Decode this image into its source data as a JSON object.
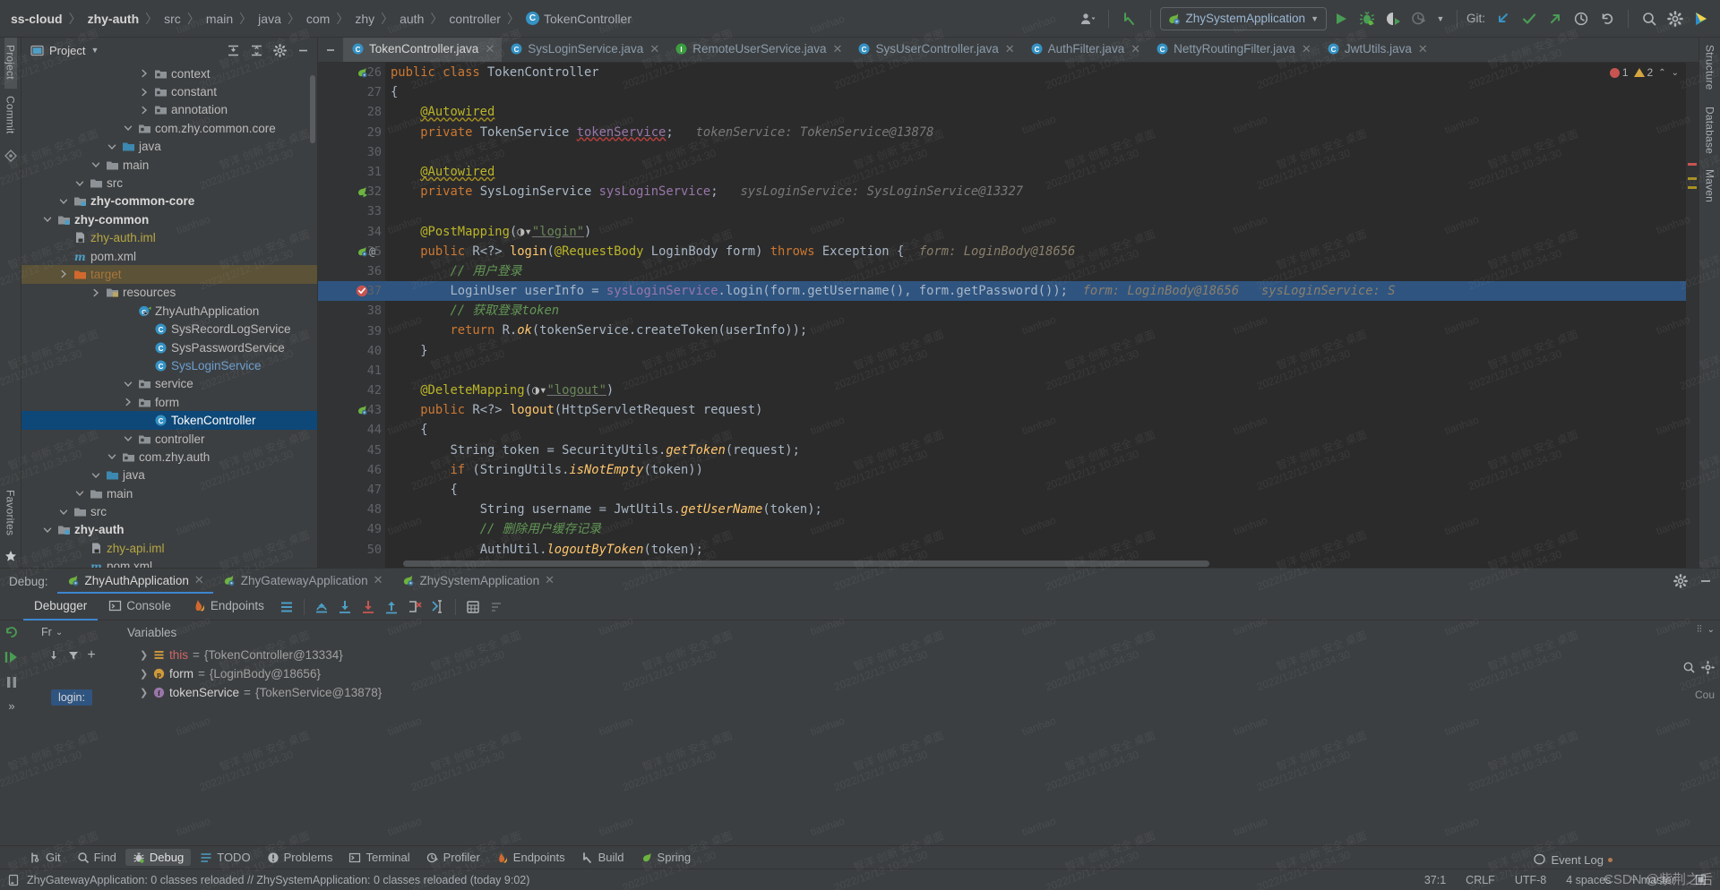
{
  "window": {
    "breadcrumbs": [
      {
        "label": "ss-cloud",
        "bold": true
      },
      {
        "label": "zhy-auth",
        "bold": true
      },
      {
        "label": "src",
        "bold": false
      },
      {
        "label": "main",
        "bold": false
      },
      {
        "label": "java",
        "bold": false
      },
      {
        "label": "com",
        "bold": false
      },
      {
        "label": "zhy",
        "bold": false
      },
      {
        "label": "auth",
        "bold": false
      },
      {
        "label": "controller",
        "bold": false
      },
      {
        "label": "TokenController",
        "bold": false,
        "icon": "class-icon"
      }
    ]
  },
  "toolbar": {
    "run_config": "ZhySystemApplication",
    "run_config_icon": "spring-boot-icon",
    "git_label": "Git:",
    "buttons": [
      {
        "name": "account-icon",
        "title": "Account"
      },
      {
        "name": "back-arrow-icon",
        "title": "Navigate Back"
      },
      {
        "name": "run-button",
        "title": "Run"
      },
      {
        "name": "debug-button",
        "title": "Debug"
      },
      {
        "name": "run-with-coverage-button",
        "title": "Run with Coverage"
      },
      {
        "name": "profiler-button",
        "title": "Profiler"
      },
      {
        "name": "update-project-button",
        "title": "Update Project"
      },
      {
        "name": "commit-button",
        "title": "Commit"
      },
      {
        "name": "push-button",
        "title": "Push"
      },
      {
        "name": "history-button",
        "title": "History"
      },
      {
        "name": "rollback-button",
        "title": "Rollback"
      },
      {
        "name": "search-everywhere-button",
        "title": "Search Everywhere"
      },
      {
        "name": "settings-gear-button",
        "title": "Settings"
      },
      {
        "name": "ide-logo-icon",
        "title": "IDE"
      }
    ]
  },
  "left_rail": [
    "Project",
    "Commit"
  ],
  "right_rail": [
    "Structure",
    "Database",
    "Maven"
  ],
  "project_panel": {
    "title": "Project",
    "tree": [
      {
        "indent": 3,
        "icon": "maven-icon",
        "label": "pom.xml",
        "color": "",
        "arrow": "",
        "state": ""
      },
      {
        "indent": 3,
        "icon": "iml-icon",
        "label": "zhy-api.iml",
        "color": "yellow",
        "arrow": "",
        "state": ""
      },
      {
        "indent": 1,
        "icon": "module-icon",
        "label": "zhy-auth",
        "color": "bold",
        "arrow": "down",
        "state": ""
      },
      {
        "indent": 2,
        "icon": "folder-icon",
        "label": "src",
        "color": "",
        "arrow": "down",
        "state": ""
      },
      {
        "indent": 3,
        "icon": "folder-icon",
        "label": "main",
        "color": "",
        "arrow": "down",
        "state": ""
      },
      {
        "indent": 4,
        "icon": "source-folder-icon",
        "label": "java",
        "color": "",
        "arrow": "down",
        "state": ""
      },
      {
        "indent": 5,
        "icon": "package-icon",
        "label": "com.zhy.auth",
        "color": "",
        "arrow": "down",
        "state": ""
      },
      {
        "indent": 6,
        "icon": "package-icon",
        "label": "controller",
        "color": "",
        "arrow": "down",
        "state": ""
      },
      {
        "indent": 7,
        "icon": "class-icon",
        "label": "TokenController",
        "color": "sel",
        "arrow": "",
        "state": "selected"
      },
      {
        "indent": 6,
        "icon": "package-icon",
        "label": "form",
        "color": "",
        "arrow": "right",
        "state": ""
      },
      {
        "indent": 6,
        "icon": "package-icon",
        "label": "service",
        "color": "",
        "arrow": "down",
        "state": ""
      },
      {
        "indent": 7,
        "icon": "class-icon",
        "label": "SysLoginService",
        "color": "blue",
        "arrow": "",
        "state": ""
      },
      {
        "indent": 7,
        "icon": "class-icon",
        "label": "SysPasswordService",
        "color": "",
        "arrow": "",
        "state": ""
      },
      {
        "indent": 7,
        "icon": "class-icon",
        "label": "SysRecordLogService",
        "color": "",
        "arrow": "",
        "state": ""
      },
      {
        "indent": 6,
        "icon": "spring-class-icon",
        "label": "ZhyAuthApplication",
        "color": "",
        "arrow": "",
        "state": ""
      },
      {
        "indent": 4,
        "icon": "resources-folder-icon",
        "label": "resources",
        "color": "",
        "arrow": "right",
        "state": ""
      },
      {
        "indent": 2,
        "icon": "target-folder-icon",
        "label": "target",
        "color": "orange",
        "arrow": "right",
        "state": "highlight"
      },
      {
        "indent": 2,
        "icon": "maven-icon",
        "label": "pom.xml",
        "color": "",
        "arrow": "",
        "state": ""
      },
      {
        "indent": 2,
        "icon": "iml-icon",
        "label": "zhy-auth.iml",
        "color": "yellow",
        "arrow": "",
        "state": ""
      },
      {
        "indent": 1,
        "icon": "module-icon",
        "label": "zhy-common",
        "color": "bold",
        "arrow": "down",
        "state": ""
      },
      {
        "indent": 2,
        "icon": "module-icon",
        "label": "zhy-common-core",
        "color": "bold",
        "arrow": "down",
        "state": ""
      },
      {
        "indent": 3,
        "icon": "folder-icon",
        "label": "src",
        "color": "",
        "arrow": "down",
        "state": ""
      },
      {
        "indent": 4,
        "icon": "folder-icon",
        "label": "main",
        "color": "",
        "arrow": "down",
        "state": ""
      },
      {
        "indent": 5,
        "icon": "source-folder-icon",
        "label": "java",
        "color": "",
        "arrow": "down",
        "state": ""
      },
      {
        "indent": 6,
        "icon": "package-icon",
        "label": "com.zhy.common.core",
        "color": "",
        "arrow": "down",
        "state": ""
      },
      {
        "indent": 7,
        "icon": "package-icon",
        "label": "annotation",
        "color": "",
        "arrow": "right",
        "state": ""
      },
      {
        "indent": 7,
        "icon": "package-icon",
        "label": "constant",
        "color": "",
        "arrow": "right",
        "state": ""
      },
      {
        "indent": 7,
        "icon": "package-icon",
        "label": "context",
        "color": "",
        "arrow": "right",
        "state": ""
      }
    ]
  },
  "editor": {
    "tabs": [
      {
        "label": "TokenController.java",
        "icon": "class-icon",
        "active": true
      },
      {
        "label": "SysLoginService.java",
        "icon": "class-icon",
        "active": false
      },
      {
        "label": "RemoteUserService.java",
        "icon": "interface-icon",
        "active": false
      },
      {
        "label": "SysUserController.java",
        "icon": "class-icon",
        "active": false
      },
      {
        "label": "AuthFilter.java",
        "icon": "class-icon",
        "active": false
      },
      {
        "label": "NettyRoutingFilter.java",
        "icon": "class-icon",
        "active": false
      },
      {
        "label": "JwtUtils.java",
        "icon": "class-icon",
        "active": false
      }
    ],
    "inspection": {
      "errors": "1",
      "warnings": "2"
    },
    "lines": [
      {
        "num": "26",
        "gutter": "spring-bean-icon",
        "html": "<span class=\"kw\">public class </span><span class=\"cls\">TokenController</span>"
      },
      {
        "num": "27",
        "gutter": "",
        "html": "<span class=\"txt\">{</span>"
      },
      {
        "num": "28",
        "gutter": "",
        "html": "    <span class=\"ann wavy-y\">@Autowired</span>"
      },
      {
        "num": "29",
        "gutter": "",
        "html": "    <span class=\"kw\">private </span><span class=\"cls\">TokenService </span><span class=\"fld wavy\">tokenService</span><span class=\"txt\">;</span>   <span class=\"hint\">tokenService: TokenService@13878</span>"
      },
      {
        "num": "30",
        "gutter": "",
        "html": ""
      },
      {
        "num": "31",
        "gutter": "",
        "html": "    <span class=\"ann wavy-y\">@Autowired</span>"
      },
      {
        "num": "32",
        "gutter": "spring-arrow-icon",
        "html": "    <span class=\"kw\">private </span><span class=\"cls\">SysLoginService </span><span class=\"fld\">sysLoginService</span><span class=\"txt\">;</span>   <span class=\"hint\">sysLoginService: SysLoginService@13327</span>"
      },
      {
        "num": "33",
        "gutter": "",
        "html": ""
      },
      {
        "num": "34",
        "gutter": "",
        "html": "    <span class=\"ann\">@PostMapping</span><span class=\"txt\">(</span><span class=\"gicon\">◑▾</span><span class=\"str sel-w\">\"login\"</span><span class=\"txt\">)</span>"
      },
      {
        "num": "35",
        "gutter": "spring-bean-icon,at-icon",
        "html": "    <span class=\"kw\">public </span><span class=\"cls\">R&lt;?&gt; </span><span class=\"mth\">login</span><span class=\"txt\">(</span><span class=\"ann\">@RequestBody </span><span class=\"cls\">LoginBody form</span><span class=\"txt\">) </span><span class=\"kw\">throws </span><span class=\"cls\">Exception </span><span class=\"txt\">{</span>  <span class=\"hintv\">form: LoginBody@18656</span>"
      },
      {
        "num": "36",
        "gutter": "",
        "html": "        <span class=\"cmt\">// 用户登录</span>"
      },
      {
        "num": "37",
        "gutter": "breakpoint-hit-icon",
        "highlight": true,
        "html": "        <span class=\"cls\">LoginUser userInfo</span> <span class=\"txt\">=</span> <span class=\"fld\">sysLoginService</span><span class=\"txt\">.</span><span class=\"txt\">login(form.getUsername(), form.getPassword());</span>  <span class=\"hintv\">form: LoginBody@18656</span>   <span class=\"hintv\">sysLoginService: S</span>"
      },
      {
        "num": "38",
        "gutter": "",
        "html": "        <span class=\"cmt\">// 获取登录token</span>"
      },
      {
        "num": "39",
        "gutter": "",
        "html": "        <span class=\"kw\">return </span><span class=\"cls\">R</span><span class=\"txt\">.</span><span class=\"mth\" style=\"font-style:italic\">ok</span><span class=\"txt\">(tokenService.createToken(userInfo));</span>"
      },
      {
        "num": "40",
        "gutter": "",
        "html": "    <span class=\"txt\">}</span>"
      },
      {
        "num": "41",
        "gutter": "",
        "html": ""
      },
      {
        "num": "42",
        "gutter": "",
        "html": "    <span class=\"ann\">@DeleteMapping</span><span class=\"txt\">(</span><span class=\"gicon\">◑▾</span><span class=\"str sel-w\">\"logout\"</span><span class=\"txt\">)</span>"
      },
      {
        "num": "43",
        "gutter": "spring-bean-icon",
        "html": "    <span class=\"kw\">public </span><span class=\"cls\">R&lt;?&gt; </span><span class=\"mth\">logout</span><span class=\"txt\">(</span><span class=\"cls\">HttpServletRequest request</span><span class=\"txt\">)</span>"
      },
      {
        "num": "44",
        "gutter": "",
        "html": "    <span class=\"txt\">{</span>"
      },
      {
        "num": "45",
        "gutter": "",
        "html": "        <span class=\"cls\">String token </span><span class=\"txt\">= </span><span class=\"cls\">SecurityUtils</span><span class=\"txt\">.</span><span class=\"mth\" style=\"font-style:italic\">getToken</span><span class=\"txt\">(request);</span>"
      },
      {
        "num": "46",
        "gutter": "",
        "html": "        <span class=\"kw\">if </span><span class=\"txt\">(</span><span class=\"cls\">StringUtils</span><span class=\"txt\">.</span><span class=\"mth\" style=\"font-style:italic\">isNotEmpty</span><span class=\"txt\">(token))</span>"
      },
      {
        "num": "47",
        "gutter": "",
        "html": "        <span class=\"txt\">{</span>"
      },
      {
        "num": "48",
        "gutter": "",
        "html": "            <span class=\"cls\">String username </span><span class=\"txt\">= </span><span class=\"cls\">JwtUtils</span><span class=\"txt\">.</span><span class=\"mth\" style=\"font-style:italic\">getUserName</span><span class=\"txt\">(token);</span>"
      },
      {
        "num": "49",
        "gutter": "",
        "html": "            <span class=\"cmt\">// 删除用户缓存记录</span>"
      },
      {
        "num": "50",
        "gutter": "",
        "html": "            <span class=\"cls\">AuthUtil</span><span class=\"txt\">.</span><span class=\"mth\" style=\"font-style:italic\">logoutByToken</span><span class=\"txt\">(token);</span>"
      }
    ]
  },
  "debug": {
    "label": "Debug:",
    "sessions": [
      {
        "label": "ZhyAuthApplication",
        "active": true
      },
      {
        "label": "ZhyGatewayApplication",
        "active": false
      },
      {
        "label": "ZhySystemApplication",
        "active": false
      }
    ],
    "subtabs": [
      {
        "label": "Debugger",
        "icon": "",
        "active": true
      },
      {
        "label": "Console",
        "icon": "console-icon",
        "active": false
      },
      {
        "label": "Endpoints",
        "icon": "endpoints-icon",
        "active": false
      }
    ],
    "step_buttons": [
      {
        "name": "show-execution-point-button"
      },
      {
        "name": "step-over-button"
      },
      {
        "name": "step-into-button"
      },
      {
        "name": "force-step-into-button"
      },
      {
        "name": "step-out-button"
      },
      {
        "name": "drop-frame-button"
      },
      {
        "name": "run-to-cursor-button"
      },
      {
        "name": "evaluate-expression-button"
      },
      {
        "name": "settings-button"
      }
    ],
    "frames_label": "Fr",
    "variables_label": "Variables",
    "frame_current": "login:",
    "variables": [
      {
        "icon": "this-icon",
        "name": "this",
        "eq": "=",
        "value": "{TokenController@13334}",
        "expandable": true
      },
      {
        "icon": "param-icon",
        "name": "form",
        "eq": "=",
        "value": "{LoginBody@18656}",
        "expandable": true
      },
      {
        "icon": "field-icon",
        "name": "tokenService",
        "eq": "=",
        "value": "{TokenService@13878}",
        "expandable": true
      }
    ]
  },
  "tool_windows": [
    {
      "label": "Git",
      "icon": "git-icon",
      "active": false
    },
    {
      "label": "Find",
      "icon": "find-icon",
      "active": false
    },
    {
      "label": "Debug",
      "icon": "debug-icon",
      "active": true
    },
    {
      "label": "TODO",
      "icon": "todo-icon",
      "active": false
    },
    {
      "label": "Problems",
      "icon": "problems-icon",
      "active": false
    },
    {
      "label": "Terminal",
      "icon": "terminal-icon",
      "active": false
    },
    {
      "label": "Profiler",
      "icon": "profiler-icon",
      "active": false
    },
    {
      "label": "Endpoints",
      "icon": "endpoints-icon",
      "active": false
    },
    {
      "label": "Build",
      "icon": "build-icon",
      "active": false
    },
    {
      "label": "Spring",
      "icon": "spring-icon",
      "active": false
    }
  ],
  "event_log": "Event Log",
  "status_bar": {
    "message": "ZhyGatewayApplication: 0 classes reloaded // ZhySystemApplication: 0 classes reloaded (today 9:02)",
    "caret": "37:1",
    "line_sep": "CRLF",
    "encoding": "UTF-8",
    "indent": "4 spaces",
    "branch": "master"
  },
  "favorites_rail": "Favorites",
  "watermark": {
    "csdn": "CSDN @紫荆之后",
    "tiles": [
      "tianhao",
      "智洋 创新 安全 桌面",
      "2022/12/12 10:34:30"
    ]
  },
  "colors": {
    "accent_blue": "#3592c4",
    "selection_blue": "#0d4878",
    "exec_line": "#2f5480",
    "breakpoint_red": "#c75450",
    "spring_green": "#6db33f",
    "editor_bg": "#2b2b2b",
    "panel_bg": "#3c3f41"
  }
}
